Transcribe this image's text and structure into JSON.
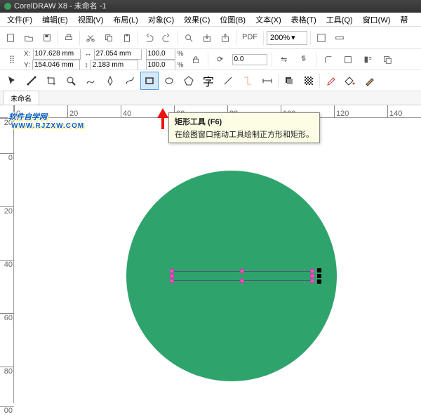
{
  "title": "CorelDRAW X8 - 未命名 -1",
  "menu": [
    "文件(F)",
    "编辑(E)",
    "视图(V)",
    "布局(L)",
    "对象(C)",
    "效果(C)",
    "位图(B)",
    "文本(X)",
    "表格(T)",
    "工具(Q)",
    "窗口(W)",
    "帮"
  ],
  "zoom": "200%",
  "pdf_label": "PDF",
  "prop": {
    "x_label": "X:",
    "y_label": "Y:",
    "x": "107.628 mm",
    "y": "154.046 mm",
    "w": "27.054 mm",
    "h": "2.183 mm",
    "sx": "100.0",
    "sy": "100.0",
    "pct": "%",
    "rot": "0.0"
  },
  "doc_tab": "未命名",
  "tooltip": {
    "title": "矩形工具 (F6)",
    "body": "在绘图窗口拖动工具绘制正方形和矩形。"
  },
  "text_tool_glyph": "字",
  "ruler_h": [
    "0",
    "20",
    "40",
    "60",
    "80",
    "100",
    "120",
    "140"
  ],
  "ruler_v": [
    "20",
    "0",
    "20",
    "40",
    "60",
    "80",
    "00"
  ],
  "watermark": {
    "main": "软件自学网",
    "sub": "WWW.RJZXW.COM"
  },
  "colors": {
    "circle": "#2fa36c",
    "handle_pink": "#e85abf"
  }
}
